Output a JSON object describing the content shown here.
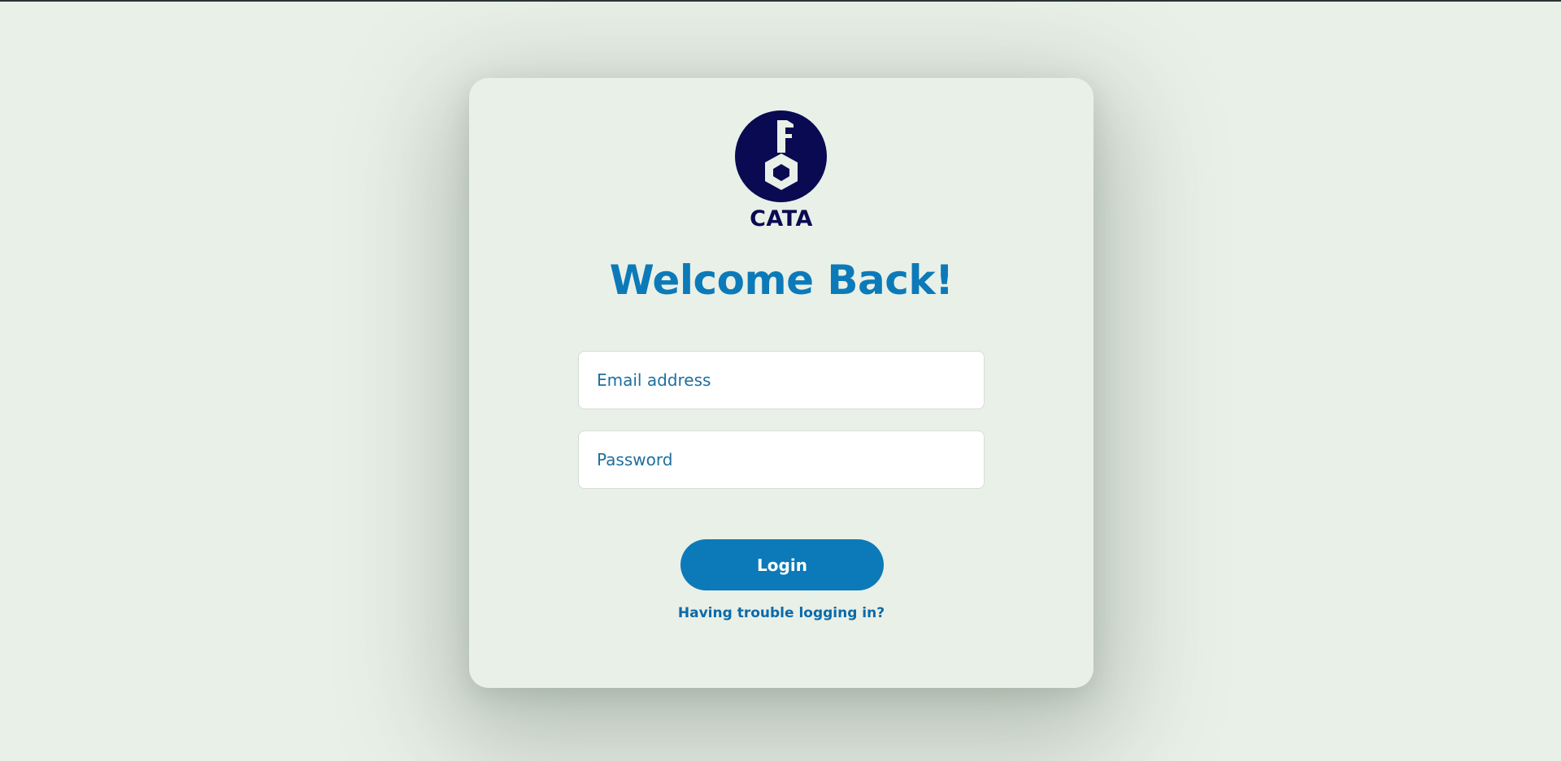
{
  "brand": {
    "name": "CATA",
    "logo_icon": "key-icon",
    "logo_color": "#0a0a52"
  },
  "login": {
    "title": "Welcome Back!",
    "email_placeholder": "Email address",
    "password_placeholder": "Password",
    "login_label": "Login",
    "trouble_link": "Having trouble logging in?"
  },
  "colors": {
    "accent": "#0c7ab8",
    "background": "#e9f0e8",
    "brand_dark": "#0a0a52"
  }
}
